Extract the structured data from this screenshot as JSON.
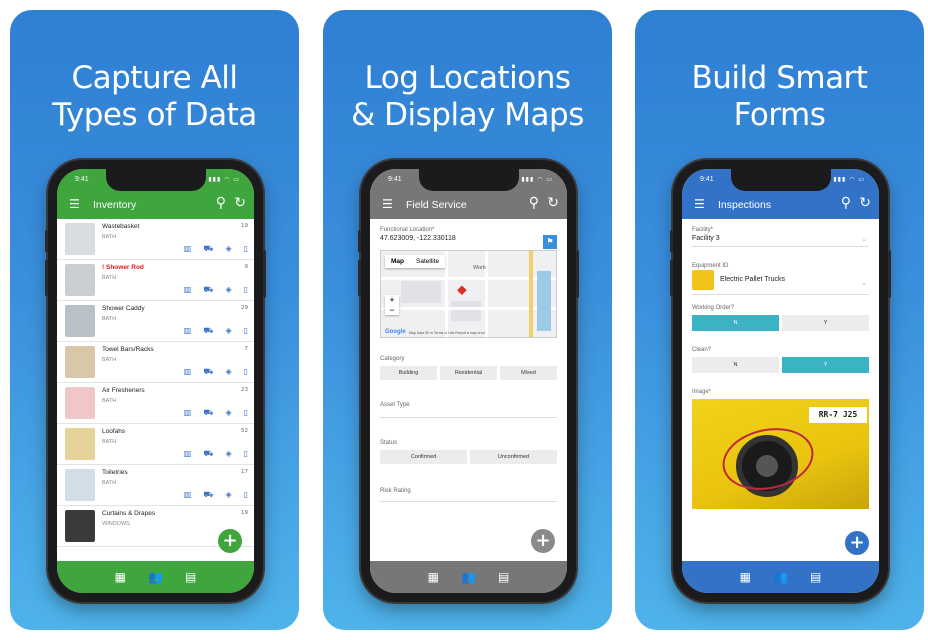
{
  "panels": [
    {
      "headline": [
        "Capture All",
        "Types of Data"
      ]
    },
    {
      "headline": [
        "Log Locations",
        "& Display Maps"
      ]
    },
    {
      "headline": [
        "Build Smart",
        "Forms"
      ]
    }
  ],
  "status": {
    "time": "9:41",
    "signal": "▮▮▮ ◠ ▭"
  },
  "colors": {
    "green": "#3ea63c",
    "gray": "#777777",
    "blue": "#3273c8",
    "panel_bg": "#3a8fdc",
    "chip_active": "#3bb3c3"
  },
  "icons": {
    "menu": "☰",
    "search": "⚲",
    "refresh": "↻",
    "add": "+",
    "calendar": "▦",
    "users": "👥",
    "grid": "▤"
  },
  "inventory": {
    "title": "Inventory",
    "items": [
      {
        "name": "Wastebasket",
        "category": "BATH",
        "qty": "19",
        "flag": false
      },
      {
        "name": "Shower Rod",
        "category": "BATH",
        "qty": "9",
        "flag": true
      },
      {
        "name": "Shower Caddy",
        "category": "BATH",
        "qty": "29",
        "flag": false
      },
      {
        "name": "Towel Bars/Racks",
        "category": "BATH",
        "qty": "7",
        "flag": false
      },
      {
        "name": "Air Fresheners",
        "category": "BATH",
        "qty": "23",
        "flag": false
      },
      {
        "name": "Loofahs",
        "category": "BATH",
        "qty": "52",
        "flag": false
      },
      {
        "name": "Toiletries",
        "category": "BATH",
        "qty": "17",
        "flag": false
      },
      {
        "name": "Curtains & Drapes",
        "category": "WINDOWS",
        "qty": "19",
        "flag": false
      }
    ]
  },
  "field_service": {
    "title": "Field Service",
    "location_label": "Functional Location*",
    "location_value": "47.623009, -122.330118",
    "map": {
      "tab_map": "Map",
      "tab_satellite": "Satellite",
      "work": "Work",
      "google": "Google",
      "footer": "Map Data  50 m  Terms of Use  Report a map error"
    },
    "category_label": "Category",
    "category_options": [
      "Building",
      "Residential",
      "Mixed"
    ],
    "asset_type_label": "Asset Type",
    "status_label": "Status",
    "status_options": [
      "Confirmed",
      "Unconfirmed"
    ],
    "risk_label": "Risk Rating"
  },
  "inspections": {
    "title": "Inspections",
    "facility_label": "Facility*",
    "facility_value": "Facility 3",
    "equipment_label": "Equipment ID",
    "equipment_value": "Electric Pallet Trucks",
    "working_label": "Working Order?",
    "working_options": [
      "N",
      "Y"
    ],
    "clean_label": "Clean?",
    "clean_options": [
      "N",
      "Y"
    ],
    "image_label": "Image*",
    "plate_text": "RR-7 J25"
  }
}
